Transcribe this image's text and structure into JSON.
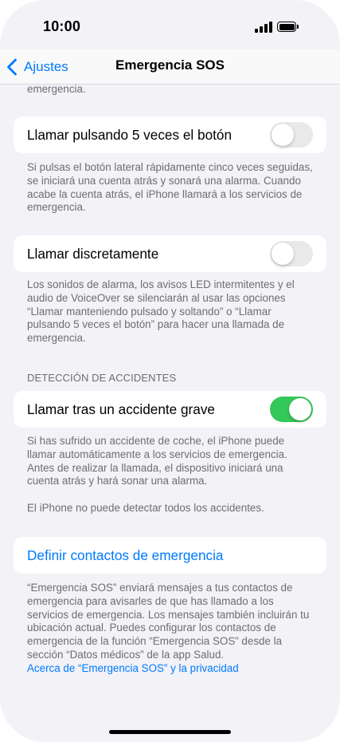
{
  "status_bar": {
    "time": "10:00"
  },
  "nav": {
    "back_label": "Ajustes",
    "title": "Emergencia SOS"
  },
  "top_fragment": "emergencia.",
  "cells": {
    "call_5_presses": {
      "label": "Llamar pulsando 5 veces el botón",
      "enabled": false,
      "footer": "Si pulsas el botón lateral rápidamente cinco veces seguidas, se iniciará una cuenta atrás y sonará una alarma. Cuando acabe la cuenta atrás, el iPhone llamará a los servicios de emergencia."
    },
    "call_silently": {
      "label": "Llamar discretamente",
      "enabled": false,
      "footer": "Los sonidos de alarma, los avisos LED intermitentes y el audio de VoiceOver se silenciarán al usar las opciones “Llamar manteniendo pulsado y soltando” o “Llamar pulsando 5 veces el botón” para hacer una llamada de emergencia."
    },
    "crash_detection": {
      "section_header": "DETECCIÓN DE ACCIDENTES",
      "label": "Llamar tras un accidente grave",
      "enabled": true,
      "footer_1": "Si has sufrido un accidente de coche, el iPhone puede llamar automáticamente a los servicios de emergencia. Antes de realizar la llamada, el dispositivo iniciará una cuenta atrás y hará sonar una alarma.",
      "footer_2": "El iPhone no puede detectar todos los accidentes."
    },
    "emergency_contacts": {
      "label": "Definir contactos de emergencia",
      "footer": "“Emergencia SOS” enviará mensajes a tus contactos de emergencia para avisarles de que has llamado a los servicios de emergencia. Los mensajes también incluirán tu ubicación actual. Puedes configurar los contactos de emergencia de la función “Emergencia SOS” desde la sección “Datos médicos” de la app Salud.",
      "privacy_link": "Acerca de “Emergencia SOS” y la privacidad"
    }
  },
  "colors": {
    "accent": "#007aff",
    "toggle_on": "#34c759",
    "toggle_off": "#e9e9ea",
    "background": "#f2f2f7",
    "secondary_text": "#6d6d72"
  },
  "icons": [
    "chevron-left-icon",
    "cellular-signal-icon",
    "battery-icon"
  ]
}
